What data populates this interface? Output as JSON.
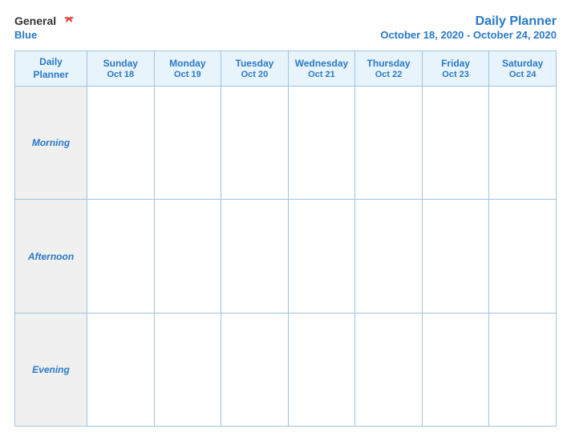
{
  "header": {
    "logo": {
      "general": "General",
      "blue": "Blue"
    },
    "title": "Daily Planner",
    "subtitle": "October 18, 2020 - October 24, 2020"
  },
  "columns": [
    {
      "id": "label",
      "day": "Daily",
      "day2": "Planner",
      "date": ""
    },
    {
      "id": "sun",
      "day": "Sunday",
      "date": "Oct 18"
    },
    {
      "id": "mon",
      "day": "Monday",
      "date": "Oct 19"
    },
    {
      "id": "tue",
      "day": "Tuesday",
      "date": "Oct 20"
    },
    {
      "id": "wed",
      "day": "Wednesday",
      "date": "Oct 21"
    },
    {
      "id": "thu",
      "day": "Thursday",
      "date": "Oct 22"
    },
    {
      "id": "fri",
      "day": "Friday",
      "date": "Oct 23"
    },
    {
      "id": "sat",
      "day": "Saturday",
      "date": "Oct 24"
    }
  ],
  "rows": [
    {
      "label": "Morning"
    },
    {
      "label": "Afternoon"
    },
    {
      "label": "Evening"
    }
  ]
}
